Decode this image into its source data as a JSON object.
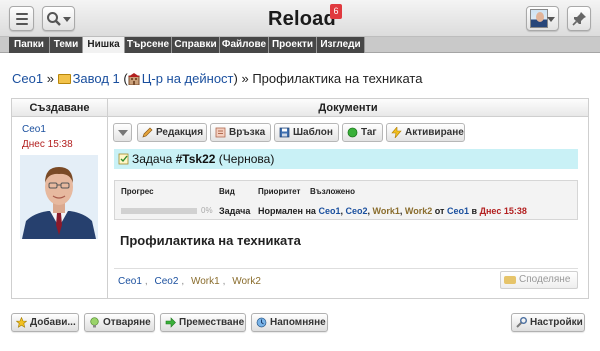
{
  "app": {
    "title": "Reload",
    "notification_count": "6"
  },
  "nav": {
    "items": [
      {
        "label": "Папки",
        "active": false
      },
      {
        "label": "Теми",
        "active": false
      },
      {
        "label": "Нишка",
        "active": true
      },
      {
        "label": "Търсене",
        "active": false
      },
      {
        "label": "Справки",
        "active": false
      },
      {
        "label": "Файлове",
        "active": false
      },
      {
        "label": "Проекти",
        "active": false
      },
      {
        "label": "Изгледи",
        "active": false
      }
    ]
  },
  "breadcrumb": {
    "root": "Ceo1",
    "sep1": "»",
    "folder": "Завод 1",
    "open_paren": "(",
    "department": "Ц-р на дейност",
    "close_paren": ")",
    "sep2": "»",
    "current": "Профилактика на техниката"
  },
  "table": {
    "col_creation": "Създаване",
    "col_documents": "Документи"
  },
  "creator": {
    "name": "Ceo1",
    "date": "Днес 15:38"
  },
  "doc_toolbar": {
    "edit": "Редакция",
    "link": "Връзка",
    "template": "Шаблон",
    "tag": "Таг",
    "activate": "Активиране"
  },
  "task": {
    "prefix": "Задача",
    "id": "#Tsk22",
    "status": "(Чернова)"
  },
  "info": {
    "progress_label": "Прогрес",
    "progress_value": 0,
    "progress_text": "0%",
    "type_label": "Вид",
    "type_value": "Задача",
    "priority_label": "Приоритет",
    "priority_value": "Нормален",
    "assigned_label": "Възложено",
    "word_on": "на",
    "assignees": [
      "Ceo1",
      "Ceo2",
      "Work1",
      "Work2"
    ],
    "word_from": "от",
    "assigner": "Ceo1",
    "word_in": "в",
    "assigned_time": "Днес 15:38"
  },
  "document": {
    "title": "Профилактика на техниката"
  },
  "tags": {
    "items": [
      "Ceo1",
      "Ceo2",
      "Work1",
      "Work2"
    ],
    "separator": ","
  },
  "share_button": "Споделяне",
  "bottom_toolbar": {
    "add": "Добави...",
    "open": "Отваряне",
    "move": "Преместване",
    "remind": "Напомняне",
    "settings": "Настройки"
  },
  "colors": {
    "link_blue": "#1a4f9e",
    "date_red": "#b32020",
    "task_bg": "#c9f1f6",
    "nav_dark": "#474747",
    "badge_red": "#e0393e"
  }
}
